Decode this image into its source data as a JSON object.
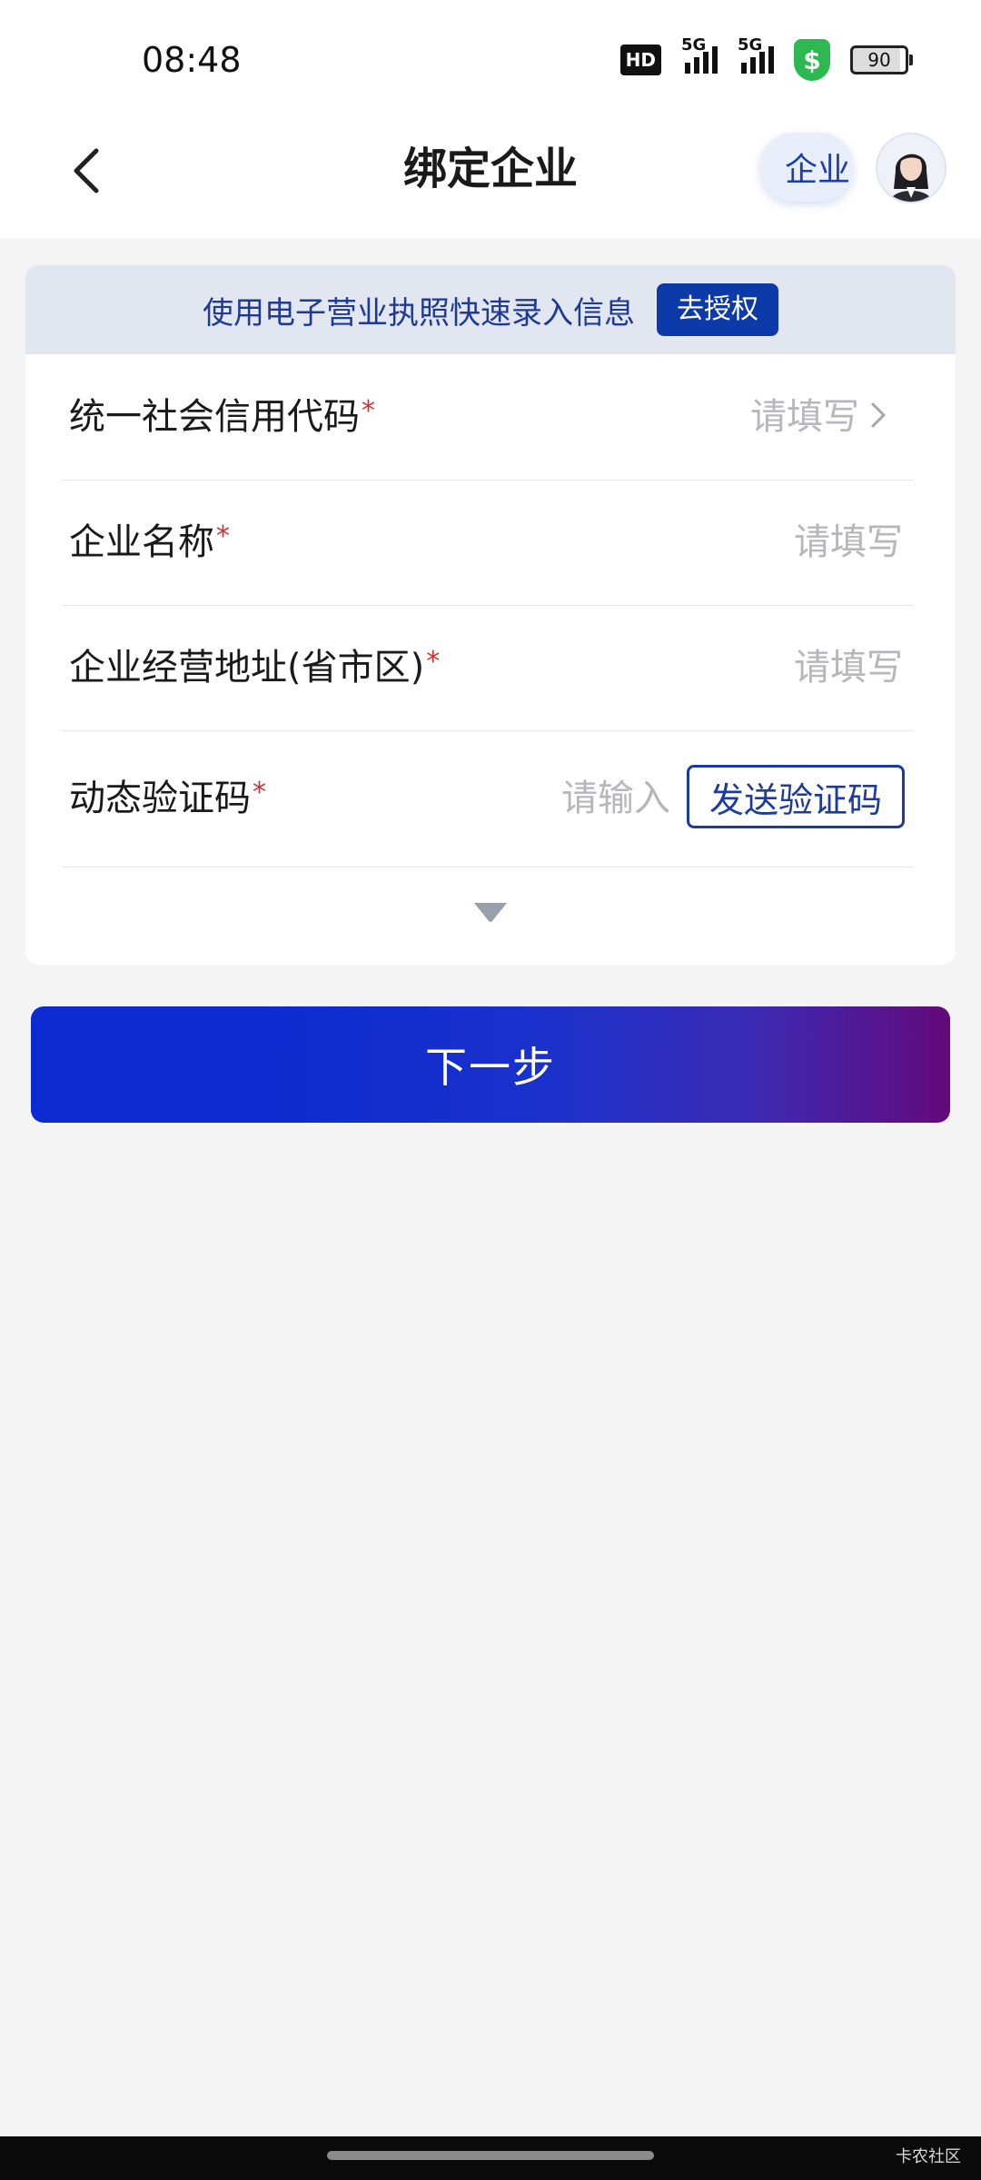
{
  "status_bar": {
    "time": "08:48",
    "hd_label": "HD",
    "network_1": "5G",
    "network_2": "5G",
    "shield_symbol": "$",
    "battery": "90"
  },
  "header": {
    "back_icon": "chevron-left-icon",
    "title": "绑定企业",
    "enterprise_tab": "企业:",
    "avatar": "assistant-avatar"
  },
  "banner": {
    "text": "使用电子营业执照快速录入信息",
    "button": "去授权"
  },
  "form": {
    "required_mark": "*",
    "fields": [
      {
        "label": "统一社会信用代码",
        "placeholder": "请填写",
        "icon": "chevron-right-icon"
      },
      {
        "label": "企业名称",
        "placeholder": "请填写"
      },
      {
        "label": "企业经营地址(省市区)",
        "placeholder": "请填写"
      },
      {
        "label": "动态验证码",
        "placeholder": "请输入",
        "button": "发送验证码"
      }
    ],
    "expand_icon": "triangle-down-icon"
  },
  "next_button": "下一步",
  "watermark": "卡农社区",
  "colors": {
    "primary": "#0d3aa9",
    "banner_bg": "#e1e6f1",
    "required": "#d03030",
    "gradient_start": "#0b2bd0",
    "gradient_end": "#64097a"
  }
}
